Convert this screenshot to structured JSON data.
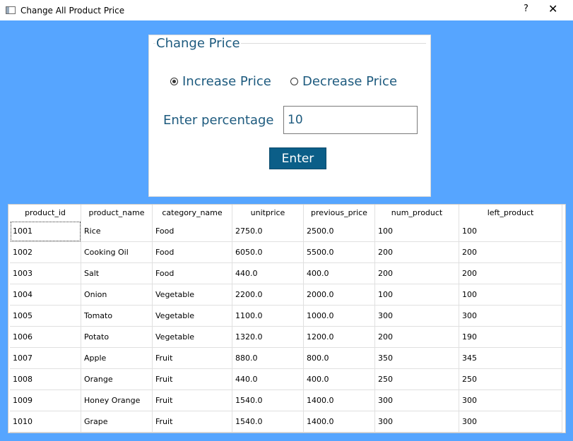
{
  "window": {
    "title": "Change All Product Price",
    "help_glyph": "?",
    "close_glyph": "✕"
  },
  "form": {
    "group_title": "Change Price",
    "radio_increase": "Increase Price",
    "radio_decrease": "Decrease Price",
    "selected_mode": "Increase Price",
    "percentage_label": "Enter percentage",
    "percentage_value": "10",
    "enter_label": "Enter"
  },
  "table": {
    "columns": [
      "product_id",
      "product_name",
      "category_name",
      "unitprice",
      "previous_price",
      "num_product",
      "left_product"
    ],
    "rows": [
      [
        "1001",
        "Rice",
        "Food",
        "2750.0",
        "2500.0",
        "100",
        "100"
      ],
      [
        "1002",
        "Cooking Oil",
        "Food",
        "6050.0",
        "5500.0",
        "200",
        "200"
      ],
      [
        "1003",
        "Salt",
        "Food",
        "440.0",
        "400.0",
        "200",
        "200"
      ],
      [
        "1004",
        "Onion",
        "Vegetable",
        "2200.0",
        "2000.0",
        "100",
        "100"
      ],
      [
        "1005",
        "Tomato",
        "Vegetable",
        "1100.0",
        "1000.0",
        "300",
        "300"
      ],
      [
        "1006",
        "Potato",
        "Vegetable",
        "1320.0",
        "1200.0",
        "200",
        "190"
      ],
      [
        "1007",
        "Apple",
        "Fruit",
        "880.0",
        "800.0",
        "350",
        "345"
      ],
      [
        "1008",
        "Orange",
        "Fruit",
        "440.0",
        "400.0",
        "250",
        "250"
      ],
      [
        "1009",
        "Honey Orange",
        "Fruit",
        "1540.0",
        "1400.0",
        "300",
        "300"
      ],
      [
        "1010",
        "Grape",
        "Fruit",
        "1540.0",
        "1400.0",
        "300",
        "300"
      ]
    ]
  }
}
